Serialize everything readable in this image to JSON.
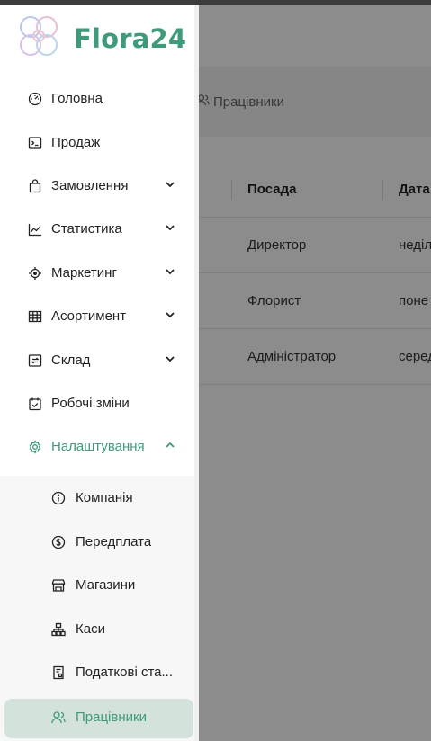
{
  "app": {
    "breadcrumb": "Працівники",
    "table": {
      "headers": [
        "Посада",
        "Дата"
      ],
      "rows": [
        [
          "Директор",
          "неділ"
        ],
        [
          "Флорист",
          "поне"
        ],
        [
          "Адміністратор",
          "серед"
        ]
      ]
    }
  },
  "drawer": {
    "logo_text": "Flora24",
    "brand_color": "#3f9a7a",
    "items": [
      {
        "label": "Головна",
        "icon": "gauge-icon"
      },
      {
        "label": "Продаж",
        "icon": "terminal-icon"
      },
      {
        "label": "Замовлення",
        "icon": "bag-icon",
        "expandable": true
      },
      {
        "label": "Статистика",
        "icon": "line-chart-icon",
        "expandable": true
      },
      {
        "label": "Маркетинг",
        "icon": "target-icon",
        "expandable": true
      },
      {
        "label": "Асортимент",
        "icon": "grid-icon",
        "expandable": true
      },
      {
        "label": "Склад",
        "icon": "box-icon",
        "expandable": true
      },
      {
        "label": "Робочі зміни",
        "icon": "calendar-check-icon"
      },
      {
        "label": "Налаштування",
        "icon": "gear-icon",
        "expandable": true,
        "expanded": true
      }
    ],
    "submenu": [
      {
        "label": "Компанія",
        "icon": "info-icon"
      },
      {
        "label": "Передплата",
        "icon": "dollar-icon"
      },
      {
        "label": "Магазини",
        "icon": "store-icon"
      },
      {
        "label": "Каси",
        "icon": "sitemap-icon"
      },
      {
        "label": "Податкові ста...",
        "icon": "receipt-icon"
      },
      {
        "label": "Працівники",
        "icon": "users-icon",
        "selected": true
      }
    ]
  }
}
